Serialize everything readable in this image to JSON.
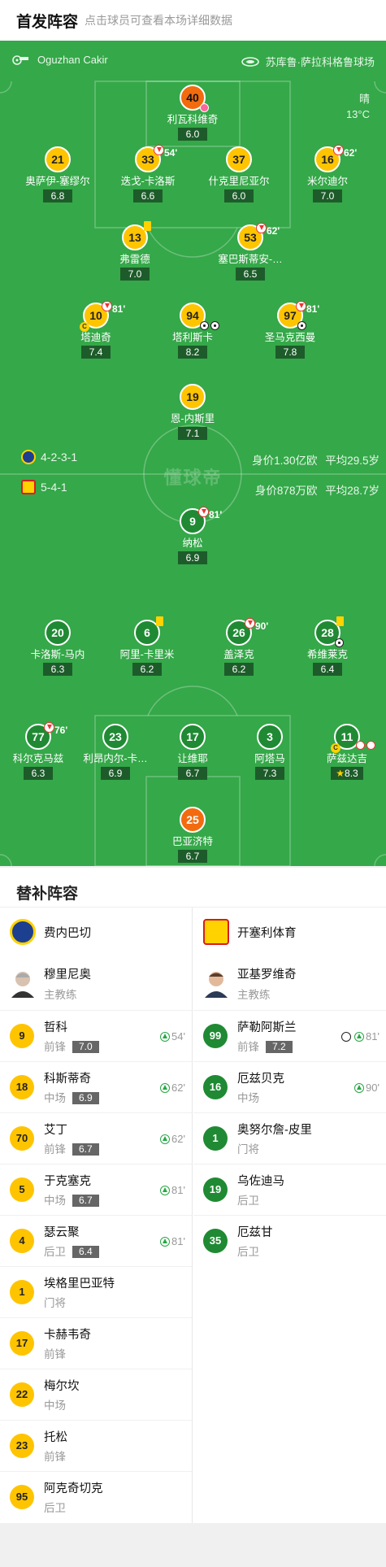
{
  "header": {
    "title": "首发阵容",
    "subtitle": "点击球员可查看本场详细数据"
  },
  "pitch": {
    "referee": "Oguzhan Cakir",
    "venue": "苏库鲁·萨拉科格鲁球场",
    "weather": "晴",
    "temperature": "13°C",
    "watermark": "懂球帝",
    "home_formation": "4-2-3-1",
    "away_formation": "5-4-1",
    "home_value": "身价1.30亿欧",
    "home_age": "平均29.5岁",
    "away_value": "身价878万欧",
    "away_age": "平均28.7岁"
  },
  "home_players": [
    {
      "num": "40",
      "name": "利瓦科维奇",
      "rating": "6.0"
    },
    {
      "num": "21",
      "name": "奥萨伊-塞缪尔",
      "rating": "6.8"
    },
    {
      "num": "33",
      "name": "迭戈-卡洛斯",
      "rating": "6.6",
      "sub": "54'"
    },
    {
      "num": "37",
      "name": "什克里尼亚尔",
      "rating": "6.0"
    },
    {
      "num": "16",
      "name": "米尔迪尔",
      "rating": "7.0",
      "sub": "62'"
    },
    {
      "num": "13",
      "name": "弗雷德",
      "rating": "7.0"
    },
    {
      "num": "53",
      "name": "塞巴斯蒂安-…",
      "rating": "6.5",
      "sub": "62'"
    },
    {
      "num": "10",
      "name": "塔迪奇",
      "rating": "7.4",
      "sub": "81'"
    },
    {
      "num": "94",
      "name": "塔利斯卡",
      "rating": "8.2"
    },
    {
      "num": "97",
      "name": "圣马克西曼",
      "rating": "7.8",
      "sub": "81'"
    },
    {
      "num": "19",
      "name": "恩-内斯里",
      "rating": "7.1"
    }
  ],
  "away_players": [
    {
      "num": "9",
      "name": "纳松",
      "rating": "6.9",
      "sub": "81'"
    },
    {
      "num": "20",
      "name": "卡洛斯-马内",
      "rating": "6.3"
    },
    {
      "num": "6",
      "name": "阿里-卡里米",
      "rating": "6.2"
    },
    {
      "num": "26",
      "name": "盖泽克",
      "rating": "6.2",
      "sub": "90'"
    },
    {
      "num": "28",
      "name": "希维莱克",
      "rating": "6.4"
    },
    {
      "num": "77",
      "name": "科尔克马兹",
      "rating": "6.3",
      "sub": "76'"
    },
    {
      "num": "23",
      "name": "利昂内尔-卡…",
      "rating": "6.9"
    },
    {
      "num": "17",
      "name": "让维耶",
      "rating": "6.7"
    },
    {
      "num": "3",
      "name": "阿塔马",
      "rating": "7.3"
    },
    {
      "num": "11",
      "name": "萨兹达吉",
      "rating": "8.3"
    },
    {
      "num": "25",
      "name": "巴亚济特",
      "rating": "6.7"
    }
  ],
  "subs": {
    "title": "替补阵容",
    "home": {
      "team": "费内巴切",
      "coach": {
        "name": "穆里尼奥",
        "role": "主教练"
      },
      "players": [
        {
          "num": "9",
          "name": "哲科",
          "pos": "前锋",
          "rating": "7.0",
          "time": "54'"
        },
        {
          "num": "18",
          "name": "科斯蒂奇",
          "pos": "中场",
          "rating": "6.9",
          "time": "62'"
        },
        {
          "num": "70",
          "name": "艾丁",
          "pos": "前锋",
          "rating": "6.7",
          "time": "62'"
        },
        {
          "num": "5",
          "name": "于克塞克",
          "pos": "中场",
          "rating": "6.7",
          "time": "81'"
        },
        {
          "num": "4",
          "name": "瑟云聚",
          "pos": "后卫",
          "rating": "6.4",
          "time": "81'"
        },
        {
          "num": "1",
          "name": "埃格里巴亚特",
          "pos": "门将"
        },
        {
          "num": "17",
          "name": "卡赫韦奇",
          "pos": "前锋"
        },
        {
          "num": "22",
          "name": "梅尔坎",
          "pos": "中场"
        },
        {
          "num": "23",
          "name": "托松",
          "pos": "前锋"
        },
        {
          "num": "95",
          "name": "阿克奇切克",
          "pos": "后卫"
        }
      ]
    },
    "away": {
      "team": "开塞利体育",
      "coach": {
        "name": "亚基罗维奇",
        "role": "主教练"
      },
      "players": [
        {
          "num": "99",
          "name": "萨勒阿斯兰",
          "pos": "前锋",
          "rating": "7.2",
          "time": "81'"
        },
        {
          "num": "16",
          "name": "厄兹贝克",
          "pos": "中场",
          "time": "90'"
        },
        {
          "num": "1",
          "name": "奥努尔詹-皮里",
          "pos": "门将"
        },
        {
          "num": "19",
          "name": "乌佐迪马",
          "pos": "后卫"
        },
        {
          "num": "35",
          "name": "厄兹甘",
          "pos": "后卫"
        }
      ]
    }
  },
  "colors": {
    "pitch": "#35a849",
    "home": "#ffc400",
    "away": "#1f8a33",
    "gk": "#f26b0f"
  }
}
